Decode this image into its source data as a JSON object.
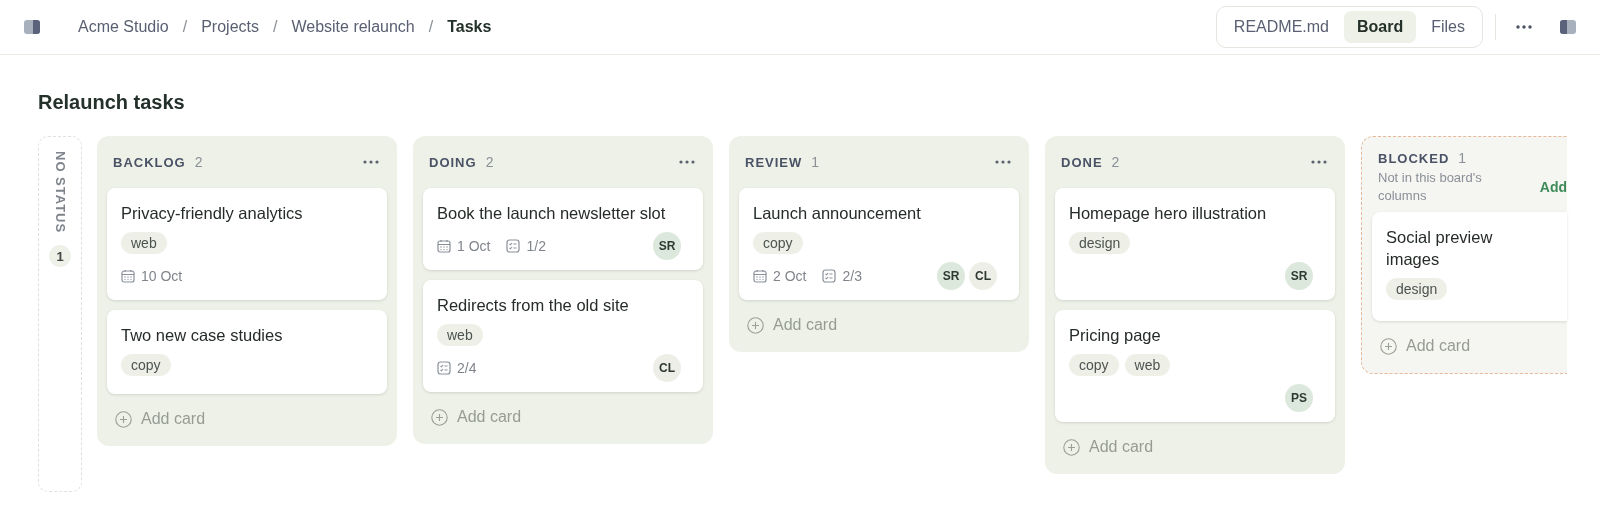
{
  "breadcrumb": [
    {
      "label": "Acme Studio",
      "current": false
    },
    {
      "label": "Projects",
      "current": false
    },
    {
      "label": "Website relaunch",
      "current": false
    },
    {
      "label": "Tasks",
      "current": true
    }
  ],
  "breadcrumb_separator": "/",
  "view_tabs": [
    {
      "label": "README.md",
      "selected": false
    },
    {
      "label": "Board",
      "selected": true
    },
    {
      "label": "Files",
      "selected": false
    }
  ],
  "title": "Relaunch tasks",
  "no_status": {
    "label": "NO STATUS",
    "count": "1"
  },
  "columns": [
    {
      "kind": "status",
      "name": "BACKLOG",
      "count": "2",
      "add_label": "Add card",
      "cards": [
        {
          "title": "Privacy-friendly analytics",
          "tags": [
            "web"
          ],
          "date": "10 Oct"
        },
        {
          "title": "Two new case studies",
          "tags": [
            "copy"
          ]
        }
      ]
    },
    {
      "kind": "status",
      "name": "DOING",
      "count": "2",
      "add_label": "Add card",
      "cards": [
        {
          "title": "Book the launch newsletter slot",
          "date": "1 Oct",
          "checklist": "1/2",
          "assignees": [
            {
              "initials": "SR",
              "color": "#dde8dc"
            }
          ]
        },
        {
          "title": "Redirects from the old site",
          "tags": [
            "web"
          ],
          "checklist": "2/4",
          "assignees": [
            {
              "initials": "CL",
              "color": "#edefe7"
            }
          ]
        }
      ]
    },
    {
      "kind": "status",
      "name": "REVIEW",
      "count": "1",
      "add_label": "Add card",
      "cards": [
        {
          "title": "Launch announcement",
          "tags": [
            "copy"
          ],
          "date": "2 Oct",
          "checklist": "2/3",
          "assignees": [
            {
              "initials": "SR",
              "color": "#dde8dc"
            },
            {
              "initials": "CL",
              "color": "#edefe7"
            }
          ]
        }
      ]
    },
    {
      "kind": "status",
      "name": "DONE",
      "count": "2",
      "add_label": "Add card",
      "cards": [
        {
          "title": "Homepage hero illustration",
          "tags": [
            "design"
          ],
          "assignees": [
            {
              "initials": "SR",
              "color": "#dde8dc"
            }
          ]
        },
        {
          "title": "Pricing page",
          "tags": [
            "copy",
            "web"
          ],
          "assignees": [
            {
              "initials": "PS",
              "color": "#dde8dc"
            }
          ]
        }
      ]
    },
    {
      "kind": "unmapped",
      "name": "BLOCKED",
      "count": "1",
      "note": "Not in this board's columns",
      "action": "Add",
      "add_label": "Add card",
      "cards": [
        {
          "title": "Social preview images",
          "tags": [
            "design"
          ]
        }
      ]
    }
  ]
}
